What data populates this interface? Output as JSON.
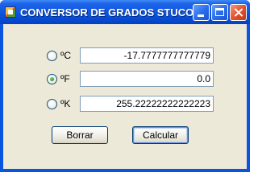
{
  "window": {
    "title": "CONVERSOR DE GRADOS STUCOM"
  },
  "icons": {
    "app": "app-icon",
    "minimize": "minimize-icon",
    "maximize": "maximize-icon",
    "close": "close-icon"
  },
  "colors": {
    "titlebar": "#0a55e0",
    "client_bg": "#ece9d8",
    "close_button": "#e3532e"
  },
  "rows": [
    {
      "unit_label": "ºC",
      "value": "-17.7777777777779",
      "selected": false
    },
    {
      "unit_label": "ºF",
      "value": "0.0",
      "selected": true
    },
    {
      "unit_label": "ºK",
      "value": "255.22222222222223",
      "selected": false
    }
  ],
  "buttons": {
    "clear_label": "Borrar",
    "calculate_label": "Calcular"
  }
}
